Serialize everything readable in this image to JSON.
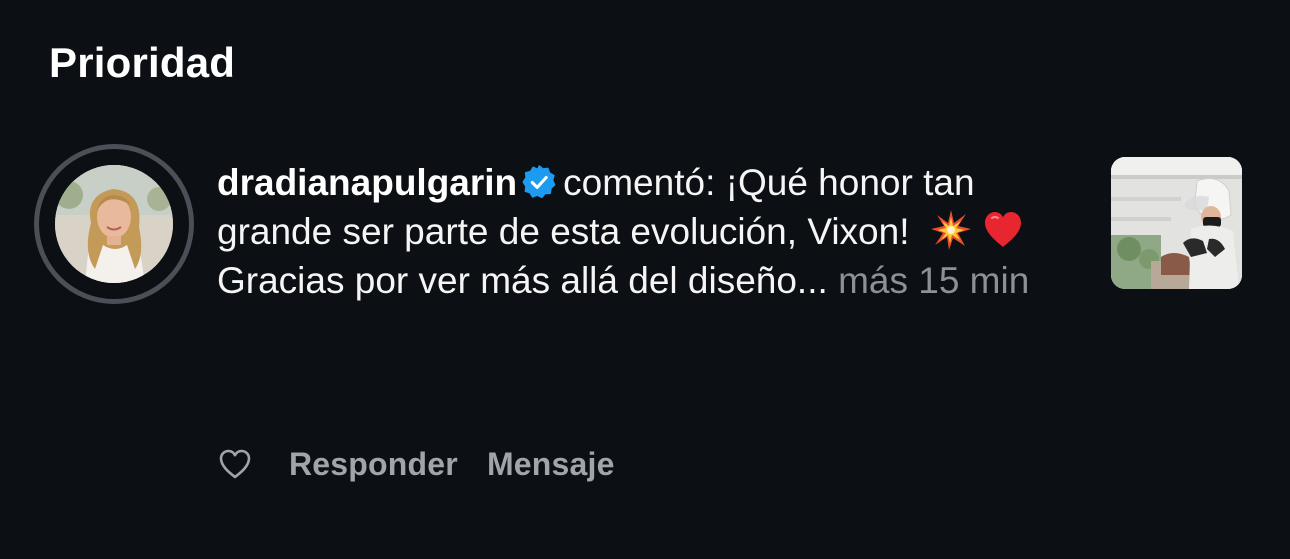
{
  "section": {
    "title": "Prioridad"
  },
  "notification": {
    "username": "dradianapulgarin",
    "verified": true,
    "action_text": "comentó:",
    "comment_line1": "¡Qué honor tan grande ser parte de esta evolución, Vixon!",
    "emojis": [
      "collision-emoji",
      "red-heart-emoji"
    ],
    "comment_line2": "Gracias por ver más allá del diseño...",
    "more_label": "más",
    "timestamp": "15 min"
  },
  "actions": {
    "reply_label": "Responder",
    "message_label": "Mensaje"
  },
  "icons": {
    "like": "heart-outline-icon",
    "verified": "verified-badge-icon"
  },
  "colors": {
    "background": "#0c0f14",
    "verified_blue": "#1d9bf0",
    "muted_text": "#8c9098"
  }
}
